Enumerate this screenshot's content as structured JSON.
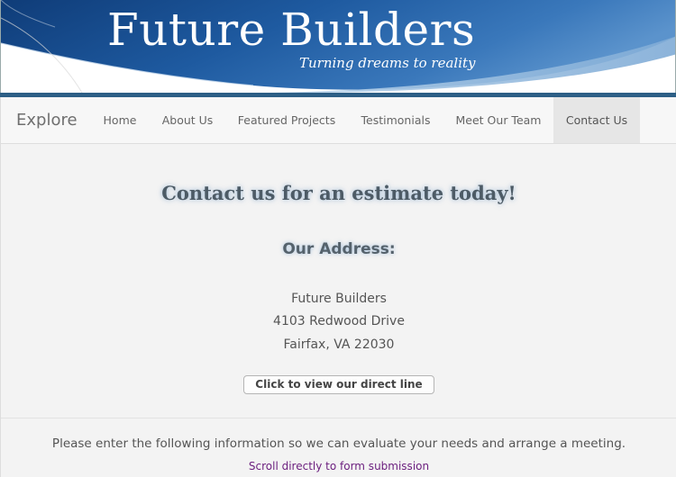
{
  "banner": {
    "title": "Future Builders",
    "tagline": "Turning dreams to reality"
  },
  "navbar": {
    "brand": "Explore",
    "items": [
      {
        "label": "Home"
      },
      {
        "label": "About Us"
      },
      {
        "label": "Featured Projects"
      },
      {
        "label": "Testimonials"
      },
      {
        "label": "Meet Our Team"
      },
      {
        "label": "Contact Us",
        "active": true
      }
    ]
  },
  "contact": {
    "headline": "Contact us for an estimate today!",
    "address_heading": "Our Address:",
    "address_lines": [
      "Future Builders",
      "4103 Redwood Drive",
      "Fairfax, VA 22030"
    ],
    "direct_line_button": "Click to view our direct line",
    "instructions": "Please enter the following information so we can evaluate your needs and arrange a meeting.",
    "scroll_link": "Scroll directly to form submission"
  },
  "colors": {
    "banner_blue_dark": "#123f7a",
    "banner_blue_light": "#3f7fbf",
    "banner_bar": "#2d5f86",
    "nav_active_bg": "#e6e6e6",
    "link_visited": "#6b1e7e"
  }
}
